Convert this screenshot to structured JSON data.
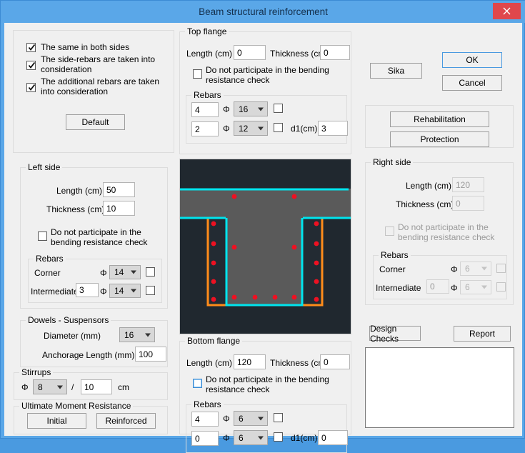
{
  "window": {
    "title": "Beam structural reinforcement",
    "close_label": "×",
    "accent_color": "#5aa7e8",
    "close_color": "#e0474c"
  },
  "options_group": {
    "checkboxes": [
      {
        "label": "The same in both sides",
        "checked": true
      },
      {
        "label": "The side-rebars are taken into consideration",
        "checked": true
      },
      {
        "label": "The additional rebars are taken into consideration",
        "checked": true
      }
    ],
    "default_button": "Default"
  },
  "left_side": {
    "legend": "Left side",
    "length_label": "Length (cm)",
    "length_value": "50",
    "thickness_label": "Thickness (cm)",
    "thickness_value": "10",
    "no_participate_label": "Do not participate in the bending resistance check",
    "no_participate_checked": false,
    "rebars": {
      "legend": "Rebars",
      "corner_label": "Corner",
      "corner_phi_symbol": "Φ",
      "corner_diameter": "14",
      "corner_extra_checked": false,
      "intermediate_label": "Intermediate",
      "intermediate_count": "3",
      "intermediate_phi_symbol": "Φ",
      "intermediate_diameter": "14",
      "intermediate_extra_checked": false
    }
  },
  "dowels": {
    "legend": "Dowels - Suspensors",
    "diameter_label": "Diameter (mm)",
    "diameter_value": "16",
    "anchorage_label": "Anchorage Length (mm)",
    "anchorage_value": "100"
  },
  "stirrups": {
    "legend": "Stirrups",
    "phi_symbol": "Φ",
    "diameter": "8",
    "separator": "/",
    "spacing": "10",
    "unit": "cm"
  },
  "ultimate_moment": {
    "legend": "Ultimate Moment Resistance",
    "initial_button": "Initial",
    "reinforced_button": "Reinforced"
  },
  "top_flange": {
    "legend": "Top flange",
    "length_label": "Length (cm)",
    "length_value": "0",
    "thickness_label": "Thickness (cm)",
    "thickness_value": "0",
    "no_participate_label": "Do not participate in the bending resistance check",
    "no_participate_checked": false,
    "rebars": {
      "legend": "Rebars",
      "row1_count": "4",
      "row1_phi_symbol": "Φ",
      "row1_diameter": "16",
      "row1_extra_checked": false,
      "row2_count": "2",
      "row2_phi_symbol": "Φ",
      "row2_diameter": "12",
      "row2_extra_checked": false,
      "d1_label": "d1(cm)",
      "d1_value": "3"
    }
  },
  "bottom_flange": {
    "legend": "Bottom flange",
    "length_label": "Length (cm)",
    "length_value": "120",
    "thickness_label": "Thickness (cm)",
    "thickness_value": "0",
    "no_participate_label": "Do not participate in the bending resistance check",
    "no_participate_checked": false,
    "no_participate_focused": true,
    "rebars": {
      "legend": "Rebars",
      "row1_count": "4",
      "row1_phi_symbol": "Φ",
      "row1_diameter": "6",
      "row1_extra_checked": false,
      "row2_count": "0",
      "row2_phi_symbol": "Φ",
      "row2_diameter": "6",
      "row2_extra_checked": false,
      "d1_label": "d1(cm)",
      "d1_value": "0"
    }
  },
  "actions": {
    "sika_button": "Sika",
    "ok_button": "OK",
    "cancel_button": "Cancel",
    "rehabilitation_button": "Rehabilitation",
    "protection_button": "Protection",
    "design_checks_button": "Design Checks",
    "report_button": "Report"
  },
  "right_side": {
    "legend": "Right side",
    "enabled": false,
    "length_label": "Length (cm)",
    "length_value": "120",
    "thickness_label": "Thickness (cm)",
    "thickness_value": "0",
    "no_participate_label": "Do not participate in the bending resistance check",
    "no_participate_checked": false,
    "rebars": {
      "legend": "Rebars",
      "corner_label": "Corner",
      "corner_phi_symbol": "Φ",
      "corner_diameter": "6",
      "corner_extra_checked": false,
      "intermediate_label": "Internediate",
      "intermediate_count": "0",
      "intermediate_phi_symbol": "Φ",
      "intermediate_diameter": "6",
      "intermediate_extra_checked": false
    }
  },
  "results_panel": {
    "content": ""
  },
  "diagram": {
    "name": "beam-cross-section",
    "background_color": "#20282f",
    "concrete_color": "#5a5a5a",
    "jacket_outline_color": "#00e5ee",
    "side_jacket_color": "#ff8c1a",
    "rebar_color": "#ee1122"
  }
}
